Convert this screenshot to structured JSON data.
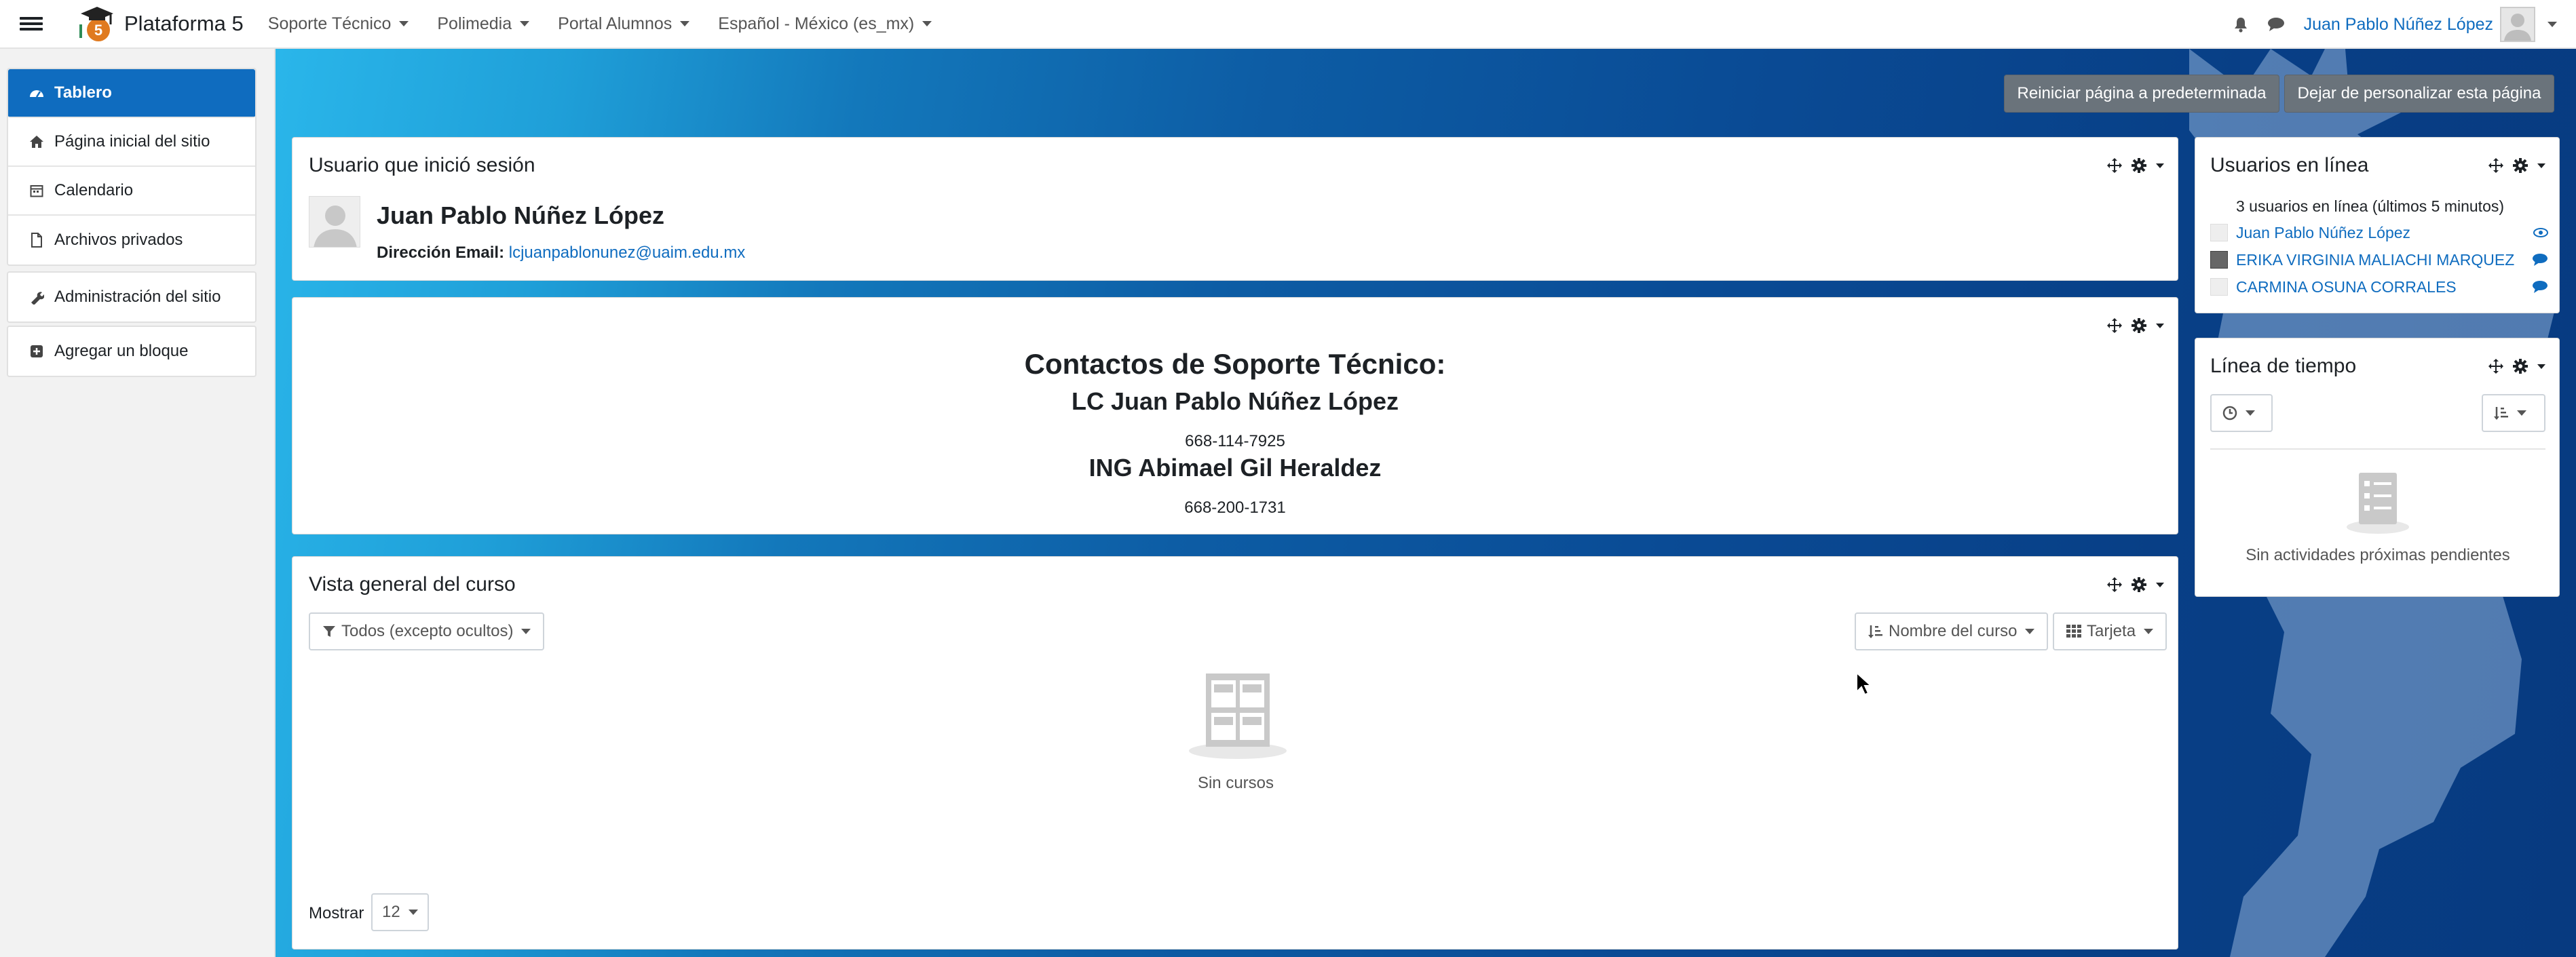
{
  "navbar": {
    "brand": "Plataforma 5",
    "menu": [
      {
        "label": "Soporte Técnico"
      },
      {
        "label": "Polimedia"
      },
      {
        "label": "Portal Alumnos"
      },
      {
        "label": "Español - México (es_mx)"
      }
    ],
    "user_name": "Juan Pablo Núñez López"
  },
  "drawer": {
    "group1": [
      {
        "label": "Tablero",
        "active": true
      },
      {
        "label": "Página inicial del sitio"
      },
      {
        "label": "Calendario"
      },
      {
        "label": "Archivos privados"
      }
    ],
    "admin": "Administración del sitio",
    "add_block": "Agregar un bloque"
  },
  "actions": {
    "reset": "Reiniciar página a predeterminada",
    "stop_customizing": "Dejar de personalizar esta página"
  },
  "logged_user": {
    "title": "Usuario que inició sesión",
    "name": "Juan Pablo Núñez López",
    "email_label": "Dirección Email:",
    "email": "lcjuanpablonunez@uaim.edu.mx"
  },
  "contacts": {
    "heading": "Contactos de Soporte Técnico:",
    "person1": "LC Juan Pablo Núñez López",
    "phone1": "668-114-7925",
    "person2": "ING Abimael Gil Heraldez",
    "phone2": "668-200-1731"
  },
  "course_overview": {
    "title": "Vista general del curso",
    "filter": "Todos (excepto ocultos)",
    "sort": "Nombre del curso",
    "view": "Tarjeta",
    "empty": "Sin cursos",
    "show_label": "Mostrar",
    "show_value": "12"
  },
  "online_users": {
    "title": "Usuarios en línea",
    "summary": "3 usuarios en línea (últimos 5 minutos)",
    "users": [
      {
        "name": "Juan Pablo Núñez López"
      },
      {
        "name": "ERIKA VIRGINIA MALIACHI MARQUEZ"
      },
      {
        "name": "CARMINA OSUNA CORRALES"
      }
    ]
  },
  "timeline": {
    "title": "Línea de tiempo",
    "empty": "Sin actividades próximas pendientes"
  },
  "colors": {
    "primary": "#0f6cbf",
    "active_nav": "#0f6cbf",
    "grey_button": "#6a737b"
  }
}
